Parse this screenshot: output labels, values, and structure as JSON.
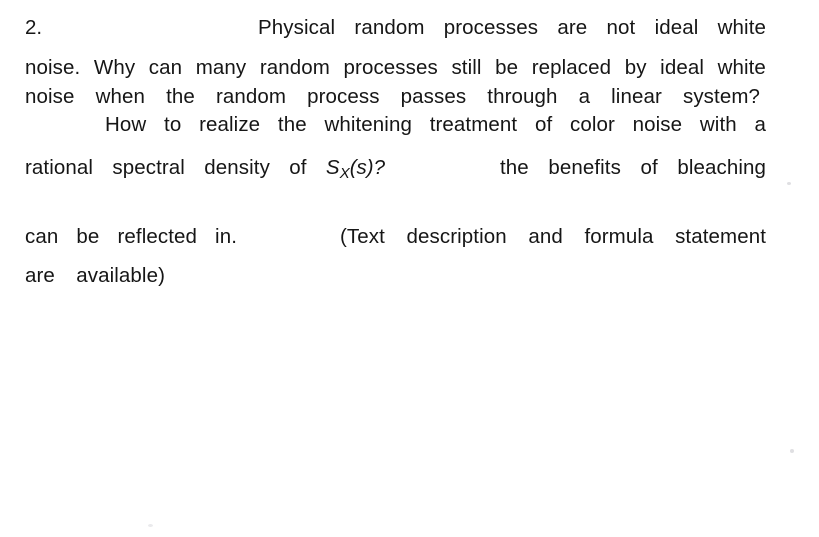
{
  "document": {
    "kind": "scanned-exam-question",
    "background_color": "#ffffff",
    "text_color": "#161616",
    "question_number": "2.",
    "lines": [
      {
        "id": "line-1",
        "words": [
          "Physical",
          "random",
          "processes",
          "are",
          "not",
          "ideal",
          "white"
        ],
        "text": "Physical random processes are not ideal white"
      },
      {
        "id": "line-2",
        "words": [
          "noise.",
          "Why",
          "can",
          "many",
          "random",
          "processes",
          "still",
          "be",
          "replaced",
          "by",
          "ideal",
          "white"
        ],
        "text": "noise. Why can many random processes still be replaced by ideal white"
      },
      {
        "id": "line-3",
        "words": [
          "noise",
          "when",
          "the",
          "random",
          "process",
          "passes",
          "through",
          "a",
          "linear",
          "system?"
        ],
        "text": "noise when the random process passes through a linear system?"
      },
      {
        "id": "line-4",
        "words": [
          "How",
          "to",
          "realize",
          "the",
          "whitening",
          "treatment",
          "of",
          "color",
          "noise",
          "with",
          "a"
        ],
        "text": "How to realize the whitening treatment of color noise with a"
      },
      {
        "id": "line-5-left",
        "words": [
          "rational",
          "spectral",
          "density",
          "of"
        ],
        "text": "rational spectral density of",
        "math": {
          "symbol": "S",
          "subscript": "X",
          "argument": "(s)",
          "trailing": "?",
          "text": "Sx(s)?"
        }
      },
      {
        "id": "line-5-right",
        "words": [
          "the",
          "benefits",
          "of",
          "bleaching"
        ],
        "text": "the benefits of bleaching"
      },
      {
        "id": "line-6-left",
        "words": [
          "can",
          "be",
          "reflected",
          "in."
        ],
        "text": "can be reflected in."
      },
      {
        "id": "line-6-right",
        "words": [
          "(Text",
          "description",
          "and",
          "formula",
          "statement"
        ],
        "text": "(Text description and formula statement"
      },
      {
        "id": "line-7",
        "words": [
          "are",
          "available)"
        ],
        "text": "are available)"
      }
    ],
    "full_text": "2. Physical random processes are not ideal white noise. Why can many random processes still be replaced by ideal white noise when the random process passes through a linear system? How to realize the whitening treatment of color noise with a rational spectral density of Sx(s)? the benefits of bleaching can be reflected in. (Text description and formula statement are available)"
  }
}
